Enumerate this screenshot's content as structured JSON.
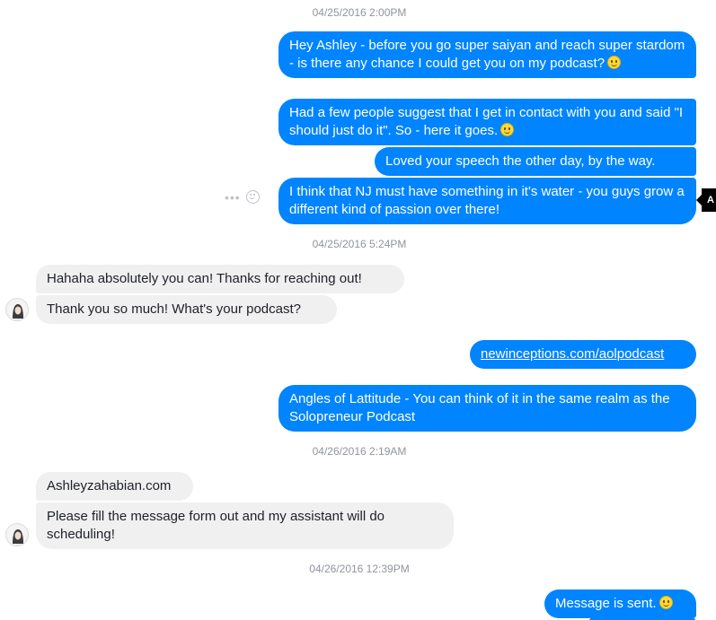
{
  "timestamps": {
    "t1": "04/25/2016 2:00PM",
    "t2": "04/25/2016 5:24PM",
    "t3": "04/26/2016 2:19AM",
    "t4": "04/26/2016 12:39PM"
  },
  "messages": {
    "m1": "Hey Ashley - before you go super saiyan and reach super stardom - is there any chance I could get you on my podcast?",
    "m2": "Had a few people suggest that I get in contact with you and said \"I should just do it\". So - here it goes.",
    "m3": "Loved your speech the other day, by the way.",
    "m4": "I think that NJ must have something in it's water - you guys grow a different kind of passion over there!",
    "m5": "Hahaha absolutely you can! Thanks for reaching out!",
    "m6": "Thank you so much! What's your podcast?",
    "m7": "newinceptions.com/aolpodcast",
    "m8": "Angles of Lattitude - You can think of it in the same realm as the Solopreneur Podcast",
    "m9": "Ashleyzahabian.com",
    "m10": "Please fill the message form out and my assistant will do scheduling!",
    "m11": "Message is sent."
  },
  "tooltip": {
    "label": "A"
  },
  "actions": {
    "more": "•••"
  },
  "icons": {
    "emoji": "slightly-smiling-face-icon",
    "reaction": "smiley-outline-icon",
    "more": "more-dots-icon",
    "avatar": "contact-avatar"
  },
  "colors": {
    "outgoing": "#0084ff",
    "incoming": "#f1f0f0",
    "timestamp": "#90949c"
  }
}
